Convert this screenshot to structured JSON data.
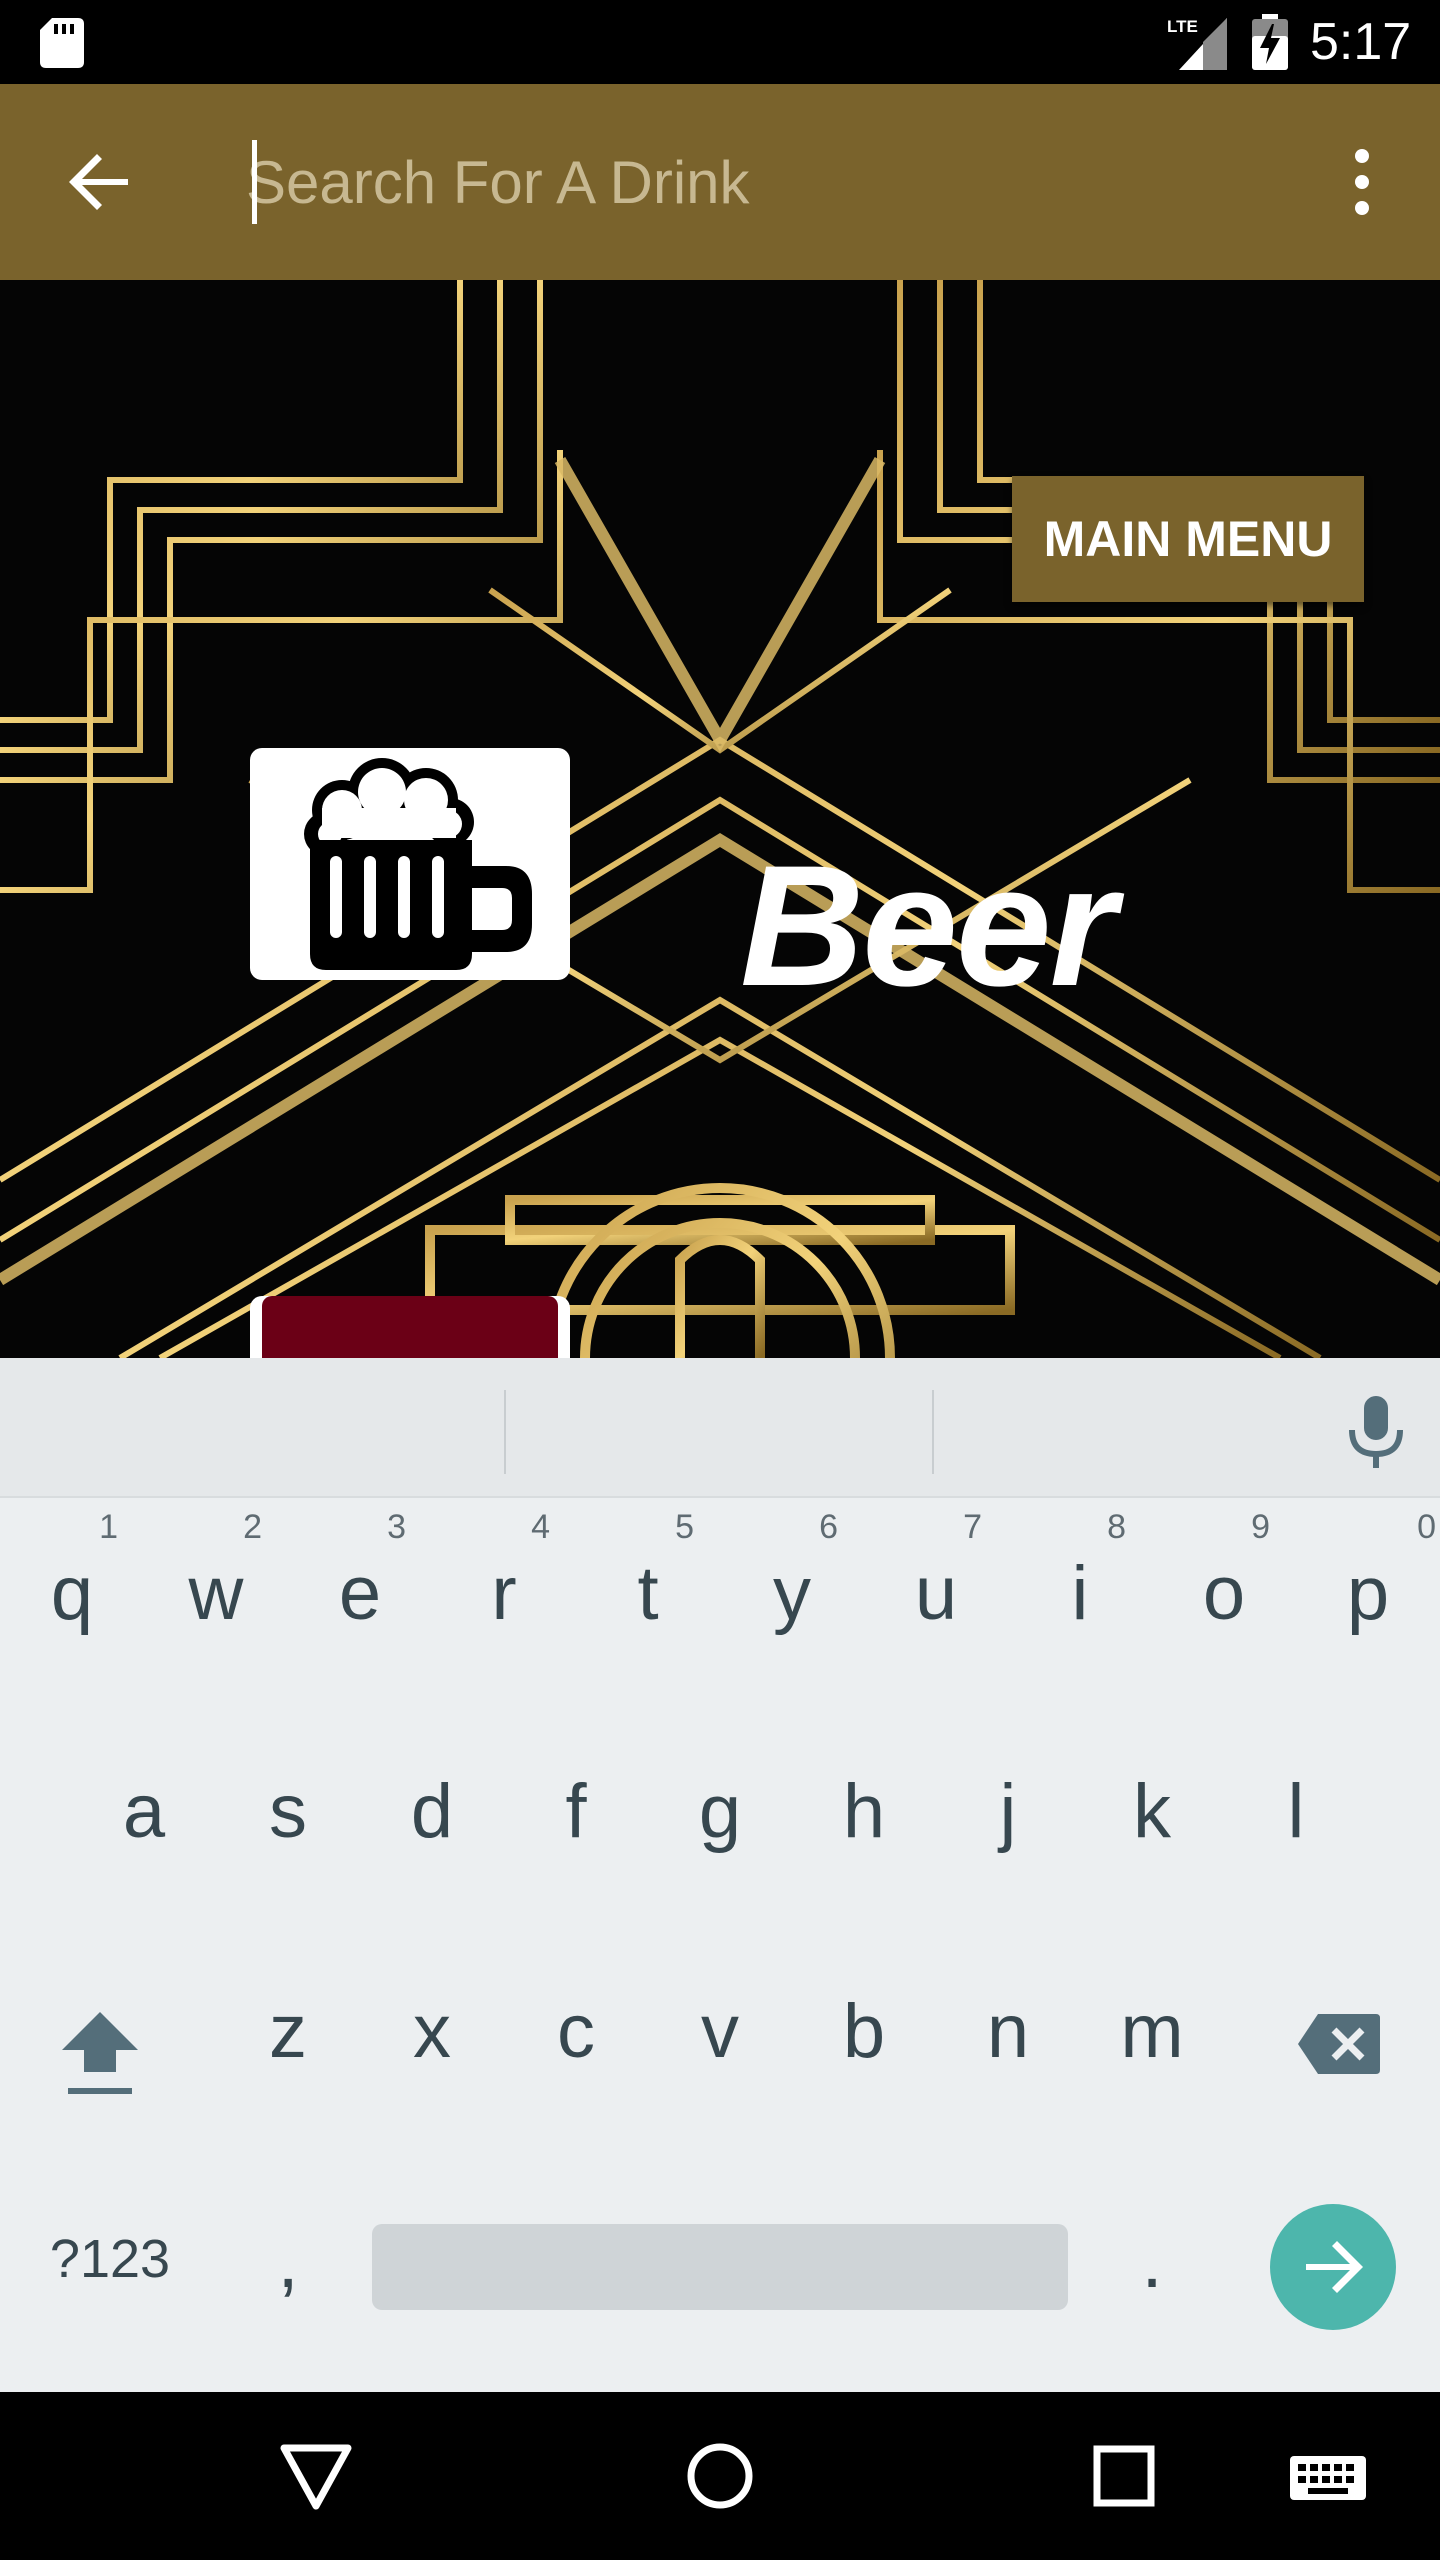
{
  "status_bar": {
    "time": "5:17",
    "network": "LTE",
    "icons": [
      "sd-card-icon",
      "lte-signal-icon",
      "battery-charging-icon"
    ]
  },
  "app_bar": {
    "search_placeholder": "Search For A Drink",
    "search_value": "",
    "back_icon": "arrow-back-icon",
    "overflow_icon": "more-vert-icon",
    "color": "#7a632c"
  },
  "content": {
    "main_menu_label": "MAIN MENU",
    "categories": [
      {
        "label": "Beer",
        "icon": "beer-mug-icon"
      }
    ]
  },
  "keyboard": {
    "row1": [
      {
        "key": "q",
        "hint": "1"
      },
      {
        "key": "w",
        "hint": "2"
      },
      {
        "key": "e",
        "hint": "3"
      },
      {
        "key": "r",
        "hint": "4"
      },
      {
        "key": "t",
        "hint": "5"
      },
      {
        "key": "y",
        "hint": "6"
      },
      {
        "key": "u",
        "hint": "7"
      },
      {
        "key": "i",
        "hint": "8"
      },
      {
        "key": "o",
        "hint": "9"
      },
      {
        "key": "p",
        "hint": "0"
      }
    ],
    "row2": [
      "a",
      "s",
      "d",
      "f",
      "g",
      "h",
      "j",
      "k",
      "l"
    ],
    "row3": [
      "z",
      "x",
      "c",
      "v",
      "b",
      "n",
      "m"
    ],
    "symbols_label": "?123",
    "comma": ",",
    "period": ".",
    "accent_color": "#4db6ac"
  },
  "nav_bar": {
    "icons": [
      "back-triangle-icon",
      "home-circle-icon",
      "recents-square-icon",
      "keyboard-icon"
    ]
  }
}
